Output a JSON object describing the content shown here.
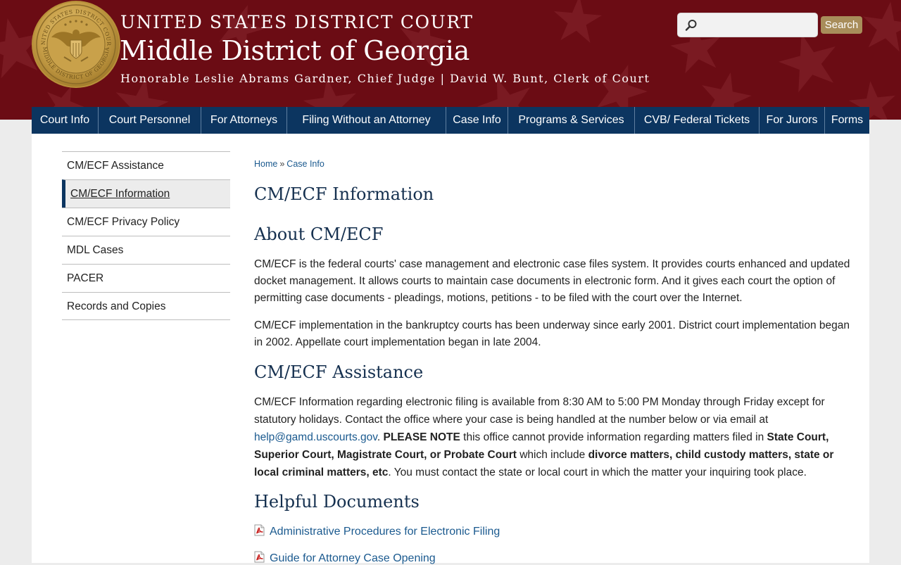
{
  "header": {
    "court_line1": "UNITED STATES DISTRICT COURT",
    "court_line2": "Middle District of Georgia",
    "court_line3": "Honorable Leslie Abrams Gardner, Chief Judge | David W. Bunt, Clerk of Court",
    "seal_text": "UNITED STATES DISTRICT COURT · MIDDLE DISTRICT OF GEORGIA",
    "search_placeholder": "",
    "search_button": "Search",
    "colors": {
      "banner": "#6b0c14",
      "button": "#a88d5a"
    }
  },
  "nav": {
    "items": [
      "Court Info",
      "Court Personnel",
      "For Attorneys",
      "Filing Without an Attorney",
      "Case Info",
      "Programs & Services",
      "CVB/ Federal Tickets",
      "For Jurors",
      "Forms"
    ],
    "color": "#0c3560"
  },
  "sidebar": {
    "items": [
      {
        "label": "CM/ECF Assistance",
        "active": false
      },
      {
        "label": "CM/ECF Information",
        "active": true
      },
      {
        "label": "CM/ECF Privacy Policy",
        "active": false
      },
      {
        "label": "MDL Cases",
        "active": false
      },
      {
        "label": "PACER",
        "active": false
      },
      {
        "label": "Records and Copies",
        "active": false
      }
    ]
  },
  "breadcrumb": {
    "home": "Home",
    "separator": "»",
    "current": "Case Info"
  },
  "main": {
    "title": "CM/ECF Information",
    "about_heading": "About CM/ECF",
    "about_p1": "CM/ECF is the federal courts' case management and electronic case files system. It provides courts enhanced and updated docket management. It allows courts to maintain case documents in electronic form. And it gives each court the option of permitting case documents - pleadings, motions, petitions - to be filed with the court over the Internet.",
    "about_p2": "CM/ECF implementation in the bankruptcy courts has been underway since early 2001. District court implementation began in 2002. Appellate court implementation began in late 2004.",
    "assist_heading": "CM/ECF Assistance",
    "assist_p_a": "CM/ECF Information regarding electronic filing is available from 8:30 AM to 5:00 PM Monday through Friday except for statutory holidays. Contact the office where your case is being handled at the number below or  via email at ",
    "assist_email": "help@gamd.uscourts.gov",
    "assist_p_b": ". ",
    "assist_note_label": "PLEASE NOTE",
    "assist_p_c": " this office cannot provide information regarding matters filed in ",
    "assist_courts": "State Court, Superior Court, Magistrate Court, or Probate Court",
    "assist_p_d": " which include ",
    "assist_matters": "divorce matters, child custody matters, state or local criminal matters, etc",
    "assist_p_e": ". You must contact the state or local court in which the matter your inquiring took place.",
    "docs_heading": "Helpful Documents",
    "documents": [
      "Administrative Procedures for Electronic Filing",
      "Guide for Attorney Case Opening"
    ]
  }
}
